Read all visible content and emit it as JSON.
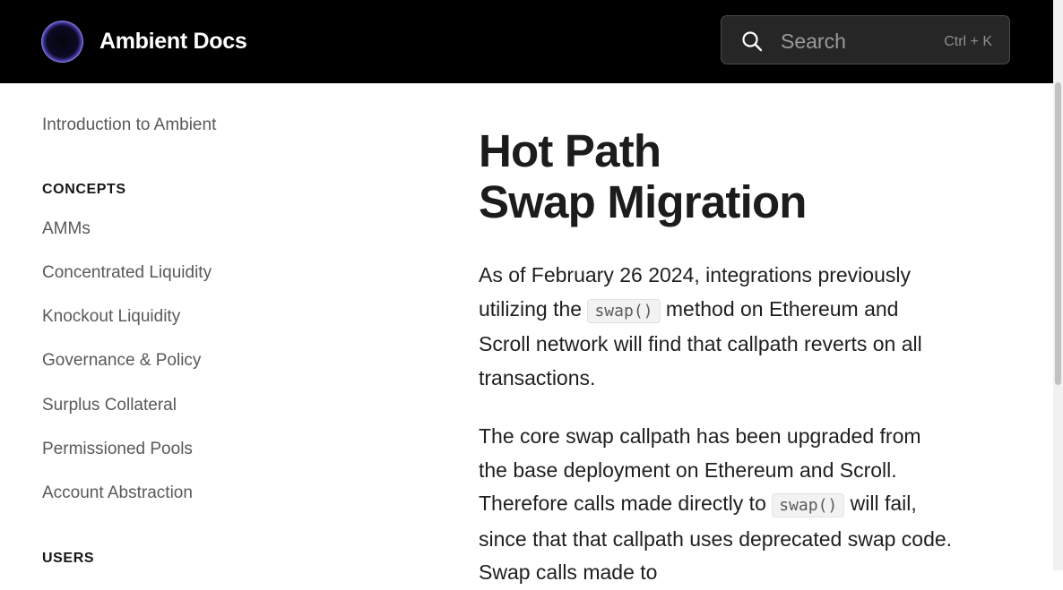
{
  "header": {
    "brand": "Ambient Docs",
    "search": {
      "placeholder": "Search",
      "shortcut": "Ctrl + K"
    }
  },
  "sidebar": {
    "intro": "Introduction to Ambient",
    "concepts": {
      "heading": "CONCEPTS",
      "items": [
        "AMMs",
        "Concentrated Liquidity",
        "Knockout Liquidity",
        "Governance & Policy",
        "Surplus Collateral",
        "Permissioned Pools",
        "Account Abstraction"
      ]
    },
    "users_heading": "USERS"
  },
  "article": {
    "title_line1": "Hot Path",
    "title_line2": "Swap Migration",
    "para1": {
      "before": "As of February 26 2024, integrations previously utilizing the",
      "code": "swap()",
      "after": "method on Ethereum and Scroll network will find that callpath reverts on all transactions."
    },
    "para2": {
      "before": "The core swap callpath has been upgraded from the base deployment on Ethereum and Scroll. Therefore calls made directly to",
      "code": "swap()",
      "after": "will fail, since that that callpath uses deprecated swap code. Swap calls made to"
    }
  },
  "colors": {
    "header_bg": "#000000",
    "accent": "#9a8ff0"
  }
}
